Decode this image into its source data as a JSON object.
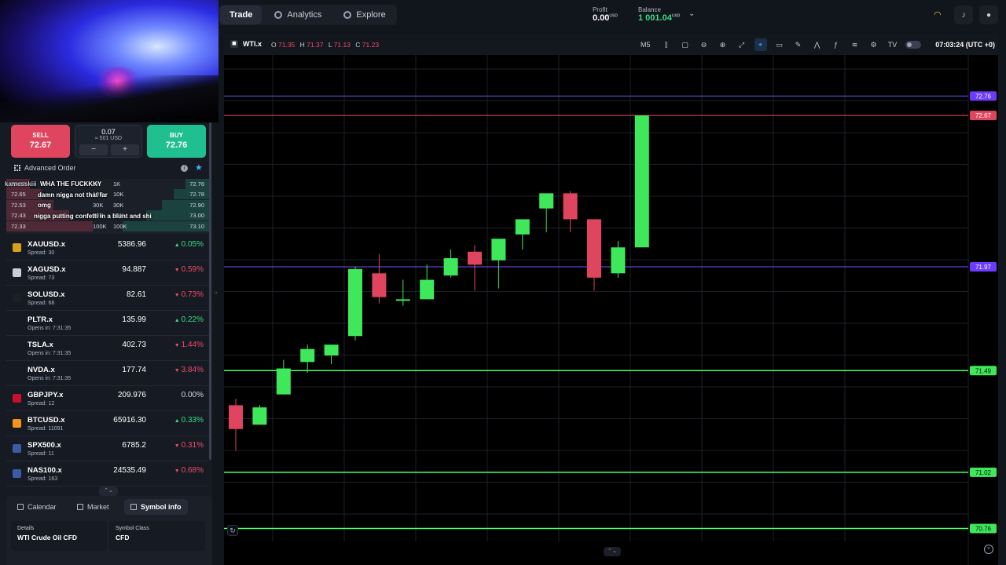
{
  "nav": {
    "tabs": [
      {
        "label": "Trade"
      },
      {
        "label": "Analytics"
      },
      {
        "label": "Explore"
      }
    ],
    "profit_label": "Profit",
    "profit_value": "0.00",
    "profit_unit": "USD",
    "balance_label": "Balance",
    "balance_value": "1 001.04",
    "balance_unit": "USD"
  },
  "order": {
    "sell_label": "SELL",
    "sell_price": "72.67",
    "buy_label": "BUY",
    "buy_price": "72.76",
    "quantity": "0.07",
    "quantity_usd": "≈ 501 USD",
    "minus": "−",
    "plus": "+",
    "advanced_label": "Advanced Order"
  },
  "depth": [
    {
      "bid": "72.67",
      "bid_vol": "1K",
      "ask_vol": "1K",
      "ask": "72.76"
    },
    {
      "bid": "72.65",
      "bid_vol": "10K",
      "ask_vol": "10K",
      "ask": "72.78"
    },
    {
      "bid": "72.53",
      "bid_vol": "30K",
      "ask_vol": "30K",
      "ask": "72.90"
    },
    {
      "bid": "72.43",
      "bid_vol": "50K",
      "ask_vol": "50K",
      "ask": "73.00"
    },
    {
      "bid": "72.33",
      "bid_vol": "100K",
      "ask_vol": "100K",
      "ask": "73.10"
    }
  ],
  "chat": [
    {
      "name": "kamesskiii",
      "text": "WHA THE FUCKKKY"
    },
    {
      "name": "",
      "text": "damn nigga not that far"
    },
    {
      "name": "",
      "text": "omg"
    },
    {
      "name": "",
      "text": "nigga putting confetti in a blunt and shi"
    }
  ],
  "symbols": [
    {
      "name": "XAUUSD.x",
      "sub": "Spread: 30",
      "price": "5386.96",
      "change": "0.05%",
      "dir": "up",
      "flag_color": "#d6a21e",
      "icon": "gold-icon"
    },
    {
      "name": "XAGUSD.x",
      "sub": "Spread: 73",
      "price": "94.887",
      "change": "0.59%",
      "dir": "dn",
      "flag_color": "#c9ced8",
      "icon": "silver-icon"
    },
    {
      "name": "SOLUSD.x",
      "sub": "Spread: 68",
      "price": "82.61",
      "change": "0.73%",
      "dir": "dn",
      "flag_color": "#1a1f28",
      "icon": "solana-icon"
    },
    {
      "name": "PLTR.x",
      "sub": "Opens in: 7:31:35",
      "price": "135.99",
      "change": "0.22%",
      "dir": "up",
      "flag_color": "#161b23",
      "icon": "palantir-icon"
    },
    {
      "name": "TSLA.x",
      "sub": "Opens in: 7:31:35",
      "price": "402.73",
      "change": "1.44%",
      "dir": "dn",
      "flag_color": "#161b23",
      "icon": "tesla-icon"
    },
    {
      "name": "NVDA.x",
      "sub": "Opens in: 7:31:35",
      "price": "177.74",
      "change": "3.84%",
      "dir": "dn",
      "flag_color": "#161b23",
      "icon": "nvidia-icon"
    },
    {
      "name": "GBPJPY.x",
      "sub": "Spread: 12",
      "price": "209.976",
      "change": "0.00%",
      "dir": "flat",
      "flag_color": "#c8102e",
      "icon": "gbpjpy-flag-icon"
    },
    {
      "name": "BTCUSD.x",
      "sub": "Spread: 11091",
      "price": "65916.30",
      "change": "0.33%",
      "dir": "up",
      "flag_color": "#f7931a",
      "icon": "bitcoin-icon"
    },
    {
      "name": "SPX500.x",
      "sub": "Spread: 11",
      "price": "6785.2",
      "change": "0.31%",
      "dir": "dn",
      "flag_color": "#3c5aa6",
      "icon": "us-flag-icon"
    },
    {
      "name": "NAS100.x",
      "sub": "Spread: 163",
      "price": "24535.49",
      "change": "0.68%",
      "dir": "dn",
      "flag_color": "#3c5aa6",
      "icon": "us-flag-icon"
    }
  ],
  "bottom_tabs": [
    {
      "label": "Calendar"
    },
    {
      "label": "Market"
    },
    {
      "label": "Symbol info"
    }
  ],
  "details": {
    "details_label": "Details",
    "details_value": "WTI Crude Oil CFD",
    "class_label": "Symbol Class",
    "class_value": "CFD"
  },
  "chart": {
    "symbol": "WTI.x",
    "o_label": "O",
    "o": "71.35",
    "h_label": "H",
    "h": "71.37",
    "l_label": "L",
    "l": "71.13",
    "c_label": "C",
    "c": "71.23",
    "timeframe": "M5",
    "clock": "07:03:24 (UTC +0)"
  },
  "chart_data": {
    "type": "candlestick",
    "symbol": "WTI.x",
    "timeframe": "M5",
    "ylim": [
      70.7,
      72.95
    ],
    "candles": [
      {
        "o": 71.33,
        "h": 71.36,
        "l": 71.12,
        "c": 71.22
      },
      {
        "o": 71.24,
        "h": 71.33,
        "l": 71.24,
        "c": 71.32
      },
      {
        "o": 71.38,
        "h": 71.54,
        "l": 71.38,
        "c": 71.5
      },
      {
        "o": 71.53,
        "h": 71.61,
        "l": 71.48,
        "c": 71.59
      },
      {
        "o": 71.56,
        "h": 71.61,
        "l": 71.52,
        "c": 71.61
      },
      {
        "o": 71.65,
        "h": 71.97,
        "l": 71.63,
        "c": 71.96
      },
      {
        "o": 71.94,
        "h": 72.03,
        "l": 71.8,
        "c": 71.83
      },
      {
        "o": 71.82,
        "h": 71.91,
        "l": 71.79,
        "c": 71.82
      },
      {
        "o": 71.82,
        "h": 71.98,
        "l": 71.82,
        "c": 71.91
      },
      {
        "o": 71.93,
        "h": 72.05,
        "l": 71.92,
        "c": 72.01
      },
      {
        "o": 72.04,
        "h": 72.07,
        "l": 71.86,
        "c": 71.98
      },
      {
        "o": 72.0,
        "h": 72.1,
        "l": 71.87,
        "c": 72.1
      },
      {
        "o": 72.12,
        "h": 72.15,
        "l": 72.05,
        "c": 72.19
      },
      {
        "o": 72.24,
        "h": 72.28,
        "l": 72.13,
        "c": 72.31
      },
      {
        "o": 72.31,
        "h": 72.32,
        "l": 72.13,
        "c": 72.19
      },
      {
        "o": 72.19,
        "h": 72.19,
        "l": 71.86,
        "c": 71.92
      },
      {
        "o": 71.94,
        "h": 72.09,
        "l": 71.92,
        "c": 72.06
      },
      {
        "o": 72.06,
        "h": 72.67,
        "l": 72.06,
        "c": 72.67
      }
    ],
    "levels": [
      {
        "price": "72.76",
        "color": "#7a4dff"
      },
      {
        "price": "72.67",
        "color": "#f04b6a"
      },
      {
        "price": "71.97",
        "color": "#7a4dff"
      },
      {
        "price": "71.49",
        "color": "#4cff6a"
      },
      {
        "price": "71.02",
        "color": "#4cff6a"
      },
      {
        "price": "70.76",
        "color": "#4cff6a"
      }
    ]
  }
}
